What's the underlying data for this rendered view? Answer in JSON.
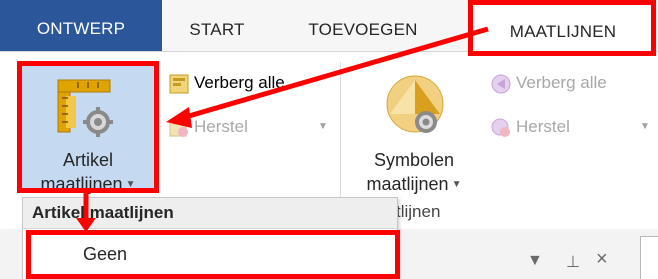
{
  "tabs": [
    {
      "label": "ONTWERP"
    },
    {
      "label": "START"
    },
    {
      "label": "TOEVOEGEN"
    },
    {
      "label": "MAATLIJNEN"
    }
  ],
  "ribbon": {
    "artikel_button": {
      "line1": "Artikel",
      "line2": "maatlijnen",
      "icon": "ruler-gear-icon"
    },
    "verberg_alle_1": {
      "label": "Verberg alle",
      "icon": "hide-icon"
    },
    "herstel_1": {
      "label": "Herstel",
      "icon": "restore-icon"
    },
    "symbolen_button": {
      "line1": "Symbolen",
      "line2": "maatlijnen",
      "icon": "symbol-gear-icon"
    },
    "verberg_alle_2": {
      "label": "Verberg alle",
      "icon": "hide-icon"
    },
    "herstel_2": {
      "label": "Herstel",
      "icon": "restore-icon"
    },
    "group_label_partial": "tlijnen"
  },
  "menu": {
    "header": "Artikel maatlijnen",
    "items": [
      {
        "label": "Geen"
      }
    ]
  },
  "colors": {
    "active_tab": "#2b579a",
    "selected_button": "#c5d9f1",
    "annotation": "#ff0000"
  }
}
